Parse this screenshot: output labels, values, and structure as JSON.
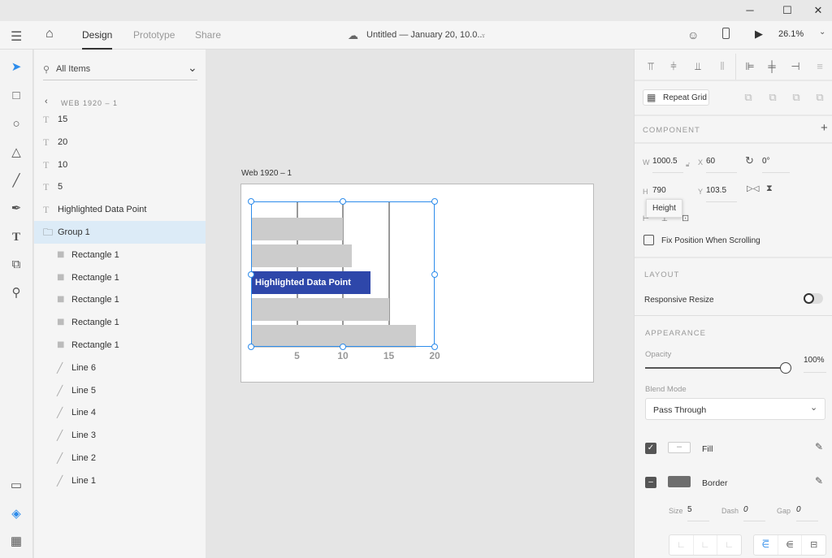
{
  "window": {
    "minimize": "─",
    "maximize": "☐",
    "close": "✕"
  },
  "appbar": {
    "tabs": [
      {
        "label": "Design",
        "active": true
      },
      {
        "label": "Prototype"
      },
      {
        "label": "Share"
      }
    ],
    "doc_title": "Untitled — January 20, 10.0...",
    "zoom": "26.1%"
  },
  "layers": {
    "filter": "All Items",
    "breadcrumb": "WEB 1920 – 1",
    "items": [
      {
        "type": "text",
        "label": "15",
        "indent": 0
      },
      {
        "type": "text",
        "label": "20",
        "indent": 0
      },
      {
        "type": "text",
        "label": "10",
        "indent": 0
      },
      {
        "type": "text",
        "label": "5",
        "indent": 0
      },
      {
        "type": "text",
        "label": "Highlighted Data Point",
        "indent": 0
      },
      {
        "type": "group",
        "label": "Group 1",
        "indent": 0,
        "selected": true
      },
      {
        "type": "rect",
        "label": "Rectangle 1",
        "indent": 1
      },
      {
        "type": "rect",
        "label": "Rectangle 1",
        "indent": 1
      },
      {
        "type": "rect",
        "label": "Rectangle 1",
        "indent": 1
      },
      {
        "type": "rect",
        "label": "Rectangle 1",
        "indent": 1
      },
      {
        "type": "rect",
        "label": "Rectangle 1",
        "indent": 1
      },
      {
        "type": "line",
        "label": "Line 6",
        "indent": 1
      },
      {
        "type": "line",
        "label": "Line 5",
        "indent": 1
      },
      {
        "type": "line",
        "label": "Line 4",
        "indent": 1
      },
      {
        "type": "line",
        "label": "Line 3",
        "indent": 1
      },
      {
        "type": "line",
        "label": "Line 2",
        "indent": 1
      },
      {
        "type": "line",
        "label": "Line 1",
        "indent": 1
      }
    ]
  },
  "artboard": {
    "name": "Web 1920 – 1"
  },
  "chart_data": {
    "type": "bar",
    "orientation": "horizontal",
    "values": [
      10,
      11,
      13,
      15,
      18
    ],
    "highlight_index": 2,
    "highlight_label": "Highlighted Data Point",
    "xticks": [
      5,
      10,
      15,
      20
    ],
    "xlim": [
      0,
      20
    ],
    "grid": true,
    "colors": {
      "bar": "#cccccc",
      "highlight": "#2e47aa"
    }
  },
  "props": {
    "repeat_grid": "Repeat Grid",
    "component": "COMPONENT",
    "w_label": "W",
    "w": "1000.5",
    "x_label": "X",
    "x": "60",
    "rotation": "0°",
    "h_label": "H",
    "h": "790",
    "y_label": "Y",
    "y": "103.5",
    "tooltip": "Height",
    "fix_position": "Fix Position When Scrolling",
    "layout": "LAYOUT",
    "responsive_resize": "Responsive Resize",
    "responsive_on": false,
    "appearance": "APPEARANCE",
    "opacity_label": "Opacity",
    "opacity": "100%",
    "blend_label": "Blend Mode",
    "blend": "Pass Through",
    "fill": "Fill",
    "fill_checked": true,
    "border": "Border",
    "border_color": "#6e6e6e",
    "size_label": "Size",
    "size": "5",
    "dash_label": "Dash",
    "dash": "0",
    "gap_label": "Gap",
    "gap": "0"
  },
  "accent": "#2d8ceb"
}
